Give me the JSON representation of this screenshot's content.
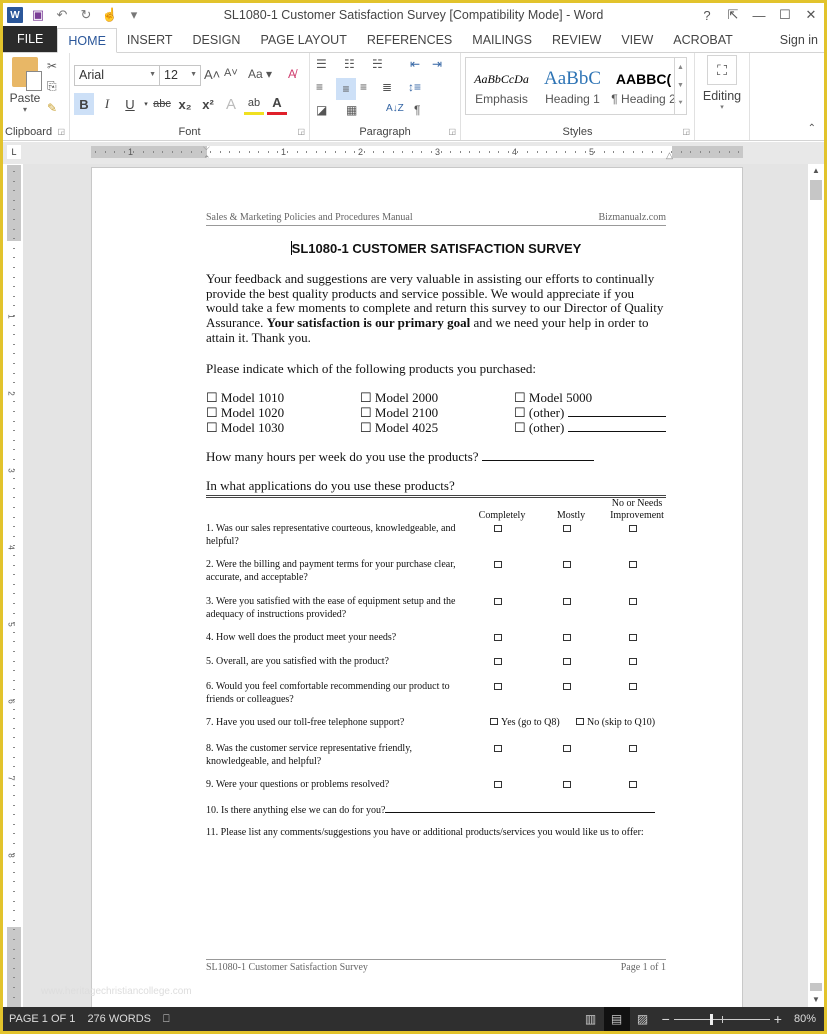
{
  "window": {
    "title": "SL1080-1 Customer Satisfaction Survey [Compatibility Mode] - Word",
    "controls": {
      "help": "?",
      "restore_ribbon": "⇱",
      "minimize": "—",
      "maximize": "☐",
      "close": "✕"
    }
  },
  "qat": {
    "word_icon": "W",
    "save_icon": "💾",
    "undo_icon": "↶",
    "redo_icon": "↻",
    "touch_icon": "☝",
    "customize_icon": "▾"
  },
  "tabs": [
    {
      "label": "FILE"
    },
    {
      "label": "HOME",
      "active": true
    },
    {
      "label": "INSERT"
    },
    {
      "label": "DESIGN"
    },
    {
      "label": "PAGE LAYOUT"
    },
    {
      "label": "REFERENCES"
    },
    {
      "label": "MAILINGS"
    },
    {
      "label": "REVIEW"
    },
    {
      "label": "VIEW"
    },
    {
      "label": "ACROBAT"
    }
  ],
  "signin": "Sign in",
  "ribbon": {
    "clipboard": {
      "label": "Clipboard",
      "paste": "Paste",
      "cut_icon": "✂",
      "copy_icon": "⎘",
      "format_painter_icon": "🖌"
    },
    "font": {
      "label": "Font",
      "font_name": "Arial",
      "font_size": "12",
      "grow": "A˄",
      "shrink": "A˅",
      "change_case": "Aa ▾",
      "clear_format": "A̸",
      "bold": "B",
      "italic": "I",
      "underline": "U",
      "strikethrough": "abc",
      "subscript": "x₂",
      "superscript": "x²",
      "text_effects": "A",
      "highlight": "ab",
      "font_color": "A"
    },
    "paragraph": {
      "label": "Paragraph",
      "bullets": "☰",
      "numbering": "☷",
      "multilevel": "☵",
      "decrease_indent": "⇤",
      "increase_indent": "⇥",
      "align_left": "≡",
      "center": "≡",
      "align_right": "≡",
      "justify": "≣",
      "line_spacing": "↕≡",
      "shading": "◪",
      "borders": "▦",
      "sort": "A↓Z",
      "show_marks": "¶"
    },
    "styles": {
      "label": "Styles",
      "items": [
        {
          "preview": "AaBbCcDa",
          "name": "Emphasis"
        },
        {
          "preview": "AaBbC",
          "name": "Heading 1"
        },
        {
          "preview": "AABBC(",
          "name": "¶ Heading 2"
        }
      ]
    },
    "editing": {
      "label": "Editing",
      "icon": "🔭"
    }
  },
  "ruler": {
    "tab_selector": "L",
    "marks": [
      "1",
      "1",
      "2",
      "3",
      "4",
      "5"
    ],
    "vmarks": [
      "1",
      "2",
      "3",
      "4",
      "5",
      "6",
      "7",
      "8"
    ]
  },
  "document": {
    "header_left": "Sales & Marketing Policies and Procedures Manual",
    "header_right": "Bizmanualz.com",
    "title": "SL1080-1 CUSTOMER SATISFACTION SURVEY",
    "intro_part1": "Your feedback and suggestions are very valuable in assisting our efforts to continually provide the best quality products and service possible.  We would appreciate if you would take a few moments to complete and return this survey to our Director of Quality Assurance.  ",
    "intro_bold": "Your satisfaction is our primary goal",
    "intro_part2": " and we need your help in order to attain it.  Thank you.",
    "products_prompt": "Please indicate which of the following products you purchased:",
    "products": [
      [
        "☐ Model 1010",
        "☐ Model 2000",
        "☐ Model 5000"
      ],
      [
        "☐ Model 1020",
        "☐ Model 2100",
        "☐ (other) "
      ],
      [
        "☐ Model 1030",
        "☐ Model 4025",
        "☐ (other) "
      ]
    ],
    "hours_question": "How many hours per week do you use the products? ",
    "applications_question": "In what applications do you use these products?",
    "columns": {
      "completely": "Completely",
      "mostly": "Mostly",
      "needs_improvement_1": "No or Needs",
      "needs_improvement_2": "Improvement"
    },
    "questions": [
      {
        "text": "1. Was our sales representative courteous, knowledgeable, and helpful?"
      },
      {
        "text": "2. Were the billing and payment terms for your purchase clear, accurate, and acceptable?"
      },
      {
        "text": "3. Were you satisfied with the ease of equipment setup and the adequacy of instructions provided?"
      },
      {
        "text": "4. How well does the product meet your needs?"
      },
      {
        "text": "5. Overall, are you satisfied with the product?"
      },
      {
        "text": "6. Would you feel comfortable recommending our product to friends or colleagues?"
      },
      {
        "text": "7. Have you used our toll-free telephone support?",
        "yes": "Yes (go to Q8)",
        "no": "No (skip to Q10)"
      },
      {
        "text": "8. Was the customer service representative friendly, knowledgeable, and helpful?"
      },
      {
        "text": "9. Were your questions or problems resolved?"
      }
    ],
    "q10": "10. Is there anything else we can do for you?",
    "q11": "11. Please list any comments/suggestions you have or additional products/services you would like us to offer:",
    "footer_left": "SL1080-1 Customer Satisfaction Survey",
    "footer_right": "Page 1 of 1",
    "watermark": "www.heritagechristiancollege.com"
  },
  "status": {
    "page": "PAGE 1 OF 1",
    "words": "276 WORDS",
    "proofing_icon": "📖",
    "read_mode_icon": "📖",
    "print_layout_icon": "▤",
    "web_layout_icon": "🗔",
    "zoom_out": "−",
    "zoom_in": "+",
    "zoom": "80%",
    "zoom_value_percent": 80
  }
}
